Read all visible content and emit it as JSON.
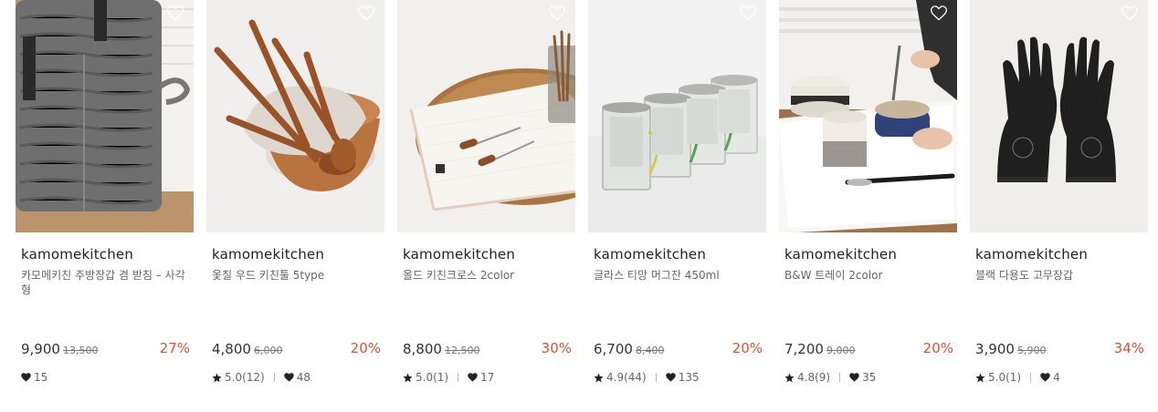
{
  "products": [
    {
      "brand": "kamomekitchen",
      "name": "카모메키친 주방장갑 겸 받침 – 사각형",
      "price": "9,900",
      "original_price": "13,500",
      "discount": "27%",
      "rating": "",
      "likes": "15",
      "image": "gray-quilted-pot-holder"
    },
    {
      "brand": "kamomekitchen",
      "name": "옻칠 우드 키친툴 5type",
      "price": "4,800",
      "original_price": "6,000",
      "discount": "20%",
      "rating": "5.0(12)",
      "likes": "48",
      "image": "wooden-kitchen-tools-in-bowl"
    },
    {
      "brand": "kamomekitchen",
      "name": "올드 키친크로스 2color",
      "price": "8,800",
      "original_price": "12,500",
      "discount": "30%",
      "rating": "5.0(1)",
      "likes": "17",
      "image": "folded-kitchen-cloth-on-tray"
    },
    {
      "brand": "kamomekitchen",
      "name": "글라스 티망 머그잔 450ml",
      "price": "6,700",
      "original_price": "8,400",
      "discount": "20%",
      "rating": "4.9(44)",
      "likes": "135",
      "image": "glass-tea-mugs"
    },
    {
      "brand": "kamomekitchen",
      "name": "B&W 트레이 2color",
      "price": "7,200",
      "original_price": "9,000",
      "discount": "20%",
      "rating": "4.8(9)",
      "likes": "35",
      "image": "white-tray-with-bowls"
    },
    {
      "brand": "kamomekitchen",
      "name": "블랙 다용도 고무장갑",
      "price": "3,900",
      "original_price": "5,900",
      "discount": "34%",
      "rating": "5.0(1)",
      "likes": "4",
      "image": "black-rubber-gloves"
    }
  ],
  "colors": {
    "discount": "#e0502e",
    "brand_text": "#222222",
    "muted_text": "#666666"
  }
}
